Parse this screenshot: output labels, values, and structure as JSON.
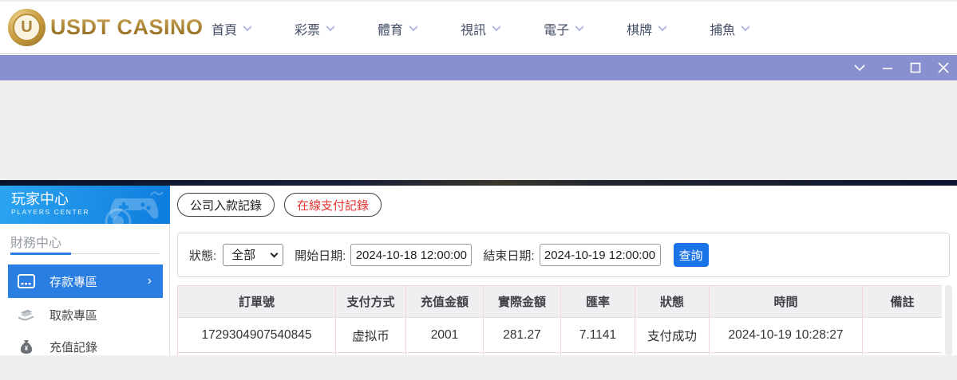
{
  "header": {
    "brand": "USDT CASINO",
    "monogram": "U",
    "nav": [
      {
        "label": "首頁"
      },
      {
        "label": "彩票"
      },
      {
        "label": "體育"
      },
      {
        "label": "視訊"
      },
      {
        "label": "電子"
      },
      {
        "label": "棋牌"
      },
      {
        "label": "捕魚"
      }
    ]
  },
  "sidebar": {
    "title": "玩家中心",
    "subtitle": "PLAYERS CENTER",
    "section_label": "財務中心",
    "items": [
      {
        "label": "存款專區",
        "active": true
      },
      {
        "label": "取款專區",
        "active": false
      },
      {
        "label": "充值記錄",
        "active": false
      }
    ]
  },
  "main": {
    "tabs": [
      {
        "label": "公司入款記錄",
        "active": false
      },
      {
        "label": "在線支付記錄",
        "active": true
      }
    ],
    "filters": {
      "status_label": "狀態:",
      "status_value": "全部",
      "start_label": "開始日期:",
      "start_value": "2024-10-18 12:00:00",
      "end_label": "結束日期:",
      "end_value": "2024-10-19 12:00:00",
      "search_label": "查詢"
    },
    "table": {
      "columns": [
        "訂單號",
        "支付方式",
        "充值金額",
        "實際金額",
        "匯率",
        "狀態",
        "時間",
        "備註"
      ],
      "rows": [
        {
          "order_no": "1729304907540845",
          "pay_method": "虚拟币",
          "recharge_amount": "2001",
          "actual_amount": "281.27",
          "rate": "7.1141",
          "status": "支付成功",
          "time": "2024-10-19 10:28:27",
          "remark": ""
        }
      ]
    }
  },
  "colors": {
    "titlebar_purple": "#8890d0",
    "sidebar_gradient_start": "#2ba4f1",
    "sidebar_gradient_end": "#0e7cdd",
    "accent_blue": "#2a7de1",
    "button_blue": "#1a74e8",
    "tab_active_red": "#e63333",
    "brand_gold": "#a8813a",
    "table_border_pink": "#f0d9d9"
  }
}
